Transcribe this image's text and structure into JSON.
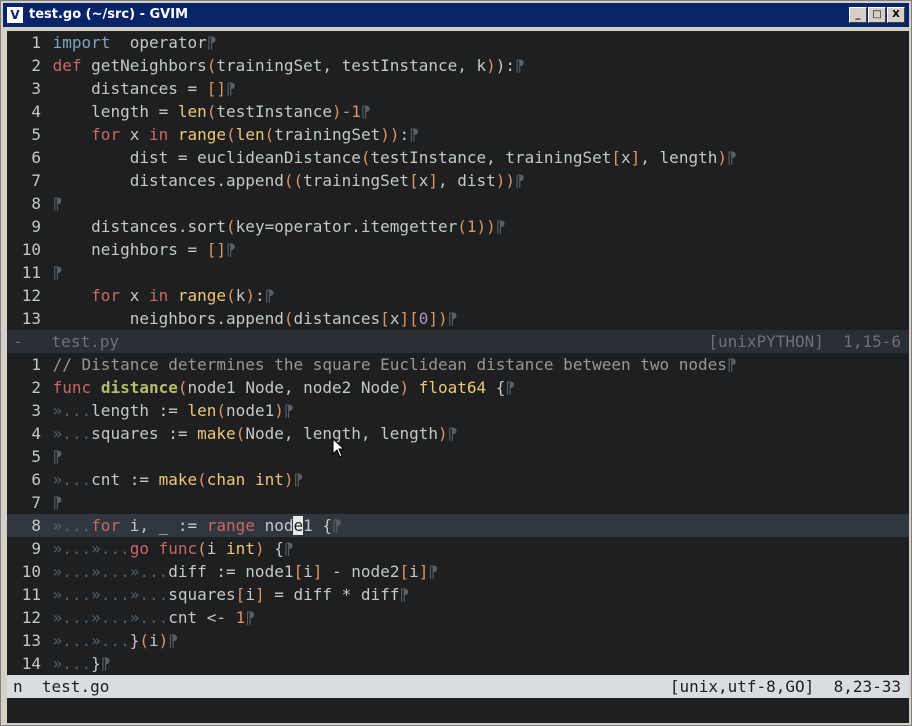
{
  "window": {
    "title": "test.go (~/src) - GVIM",
    "app_icon": "vim-icon",
    "buttons": [
      "_",
      "□",
      "X"
    ]
  },
  "top_pane": {
    "lines": [
      [
        [
          "kw",
          "import"
        ],
        [
          "",
          "  operator"
        ],
        [
          "eol",
          "⁋"
        ]
      ],
      [
        [
          "def",
          "def "
        ],
        [
          "",
          "getNeighbors"
        ],
        [
          "br",
          "("
        ],
        [
          "",
          "trainingSet, testInstance, k"
        ],
        [
          "br",
          ")"
        ],
        [
          "",
          "):"
        ],
        [
          "eol",
          "⁋"
        ]
      ],
      [
        [
          "",
          "    distances = "
        ],
        [
          "br",
          "[]"
        ],
        [
          "eol",
          "⁋"
        ]
      ],
      [
        [
          "",
          "    length = "
        ],
        [
          "fn",
          "len"
        ],
        [
          "br",
          "("
        ],
        [
          "",
          "testInstance"
        ],
        [
          "br",
          ")"
        ],
        [
          "num",
          "-1"
        ],
        [
          "eol",
          "⁋"
        ]
      ],
      [
        [
          "",
          "    "
        ],
        [
          "def",
          "for"
        ],
        [
          "",
          " x "
        ],
        [
          "def",
          "in"
        ],
        [
          "",
          " "
        ],
        [
          "fn",
          "range"
        ],
        [
          "br",
          "("
        ],
        [
          "fn",
          "len"
        ],
        [
          "br",
          "("
        ],
        [
          "",
          "trainingSet"
        ],
        [
          "br",
          "))"
        ],
        [
          "",
          ":"
        ],
        [
          "eol",
          "⁋"
        ]
      ],
      [
        [
          "",
          "        dist = euclideanDistance"
        ],
        [
          "br",
          "("
        ],
        [
          "",
          "testInstance, trainingSet"
        ],
        [
          "br",
          "["
        ],
        [
          "",
          "x"
        ],
        [
          "br",
          "]"
        ],
        [
          "",
          ", length"
        ],
        [
          "br",
          ")"
        ],
        [
          "eol",
          "⁋"
        ]
      ],
      [
        [
          "",
          "        distances.append"
        ],
        [
          "br",
          "(("
        ],
        [
          "",
          "trainingSet"
        ],
        [
          "br",
          "["
        ],
        [
          "",
          "x"
        ],
        [
          "br",
          "]"
        ],
        [
          "",
          ", dist"
        ],
        [
          "br",
          "))"
        ],
        [
          "eol",
          "⁋"
        ]
      ],
      [
        [
          "eol",
          "⁋"
        ]
      ],
      [
        [
          "",
          "    distances.sort"
        ],
        [
          "br",
          "("
        ],
        [
          "",
          "key=operator.itemgetter"
        ],
        [
          "br",
          "("
        ],
        [
          "num",
          "1"
        ],
        [
          "br",
          "))"
        ],
        [
          "eol",
          "⁋"
        ]
      ],
      [
        [
          "",
          "    neighbors = "
        ],
        [
          "br",
          "[]"
        ],
        [
          "eol",
          "⁋"
        ]
      ],
      [
        [
          "eol",
          "⁋"
        ]
      ],
      [
        [
          "",
          "    "
        ],
        [
          "def",
          "for"
        ],
        [
          "",
          " x "
        ],
        [
          "def",
          "in"
        ],
        [
          "",
          " "
        ],
        [
          "fn",
          "range"
        ],
        [
          "br",
          "("
        ],
        [
          "",
          "k"
        ],
        [
          "br",
          ")"
        ],
        [
          "",
          ":"
        ],
        [
          "eol",
          "⁋"
        ]
      ],
      [
        [
          "",
          "        neighbors.append"
        ],
        [
          "br",
          "("
        ],
        [
          "",
          "distances"
        ],
        [
          "br",
          "["
        ],
        [
          "",
          "x"
        ],
        [
          "br",
          "]["
        ],
        [
          "pur",
          "0"
        ],
        [
          "br",
          "])"
        ],
        [
          "eol",
          "⁋"
        ]
      ]
    ],
    "numbers": [
      "1",
      "2",
      "3",
      "4",
      "5",
      "6",
      "7",
      "8",
      "9",
      "10",
      "11",
      "12",
      "13"
    ],
    "status": {
      "marker": "-",
      "file": "test.py",
      "info": "[unixPYTHON]  1,15-6"
    }
  },
  "bottom_pane": {
    "lines": [
      [
        [
          "cmt",
          "// Distance determines the square Euclidean distance between two nodes"
        ],
        [
          "eol",
          "⁋"
        ]
      ],
      [
        [
          "def",
          "func "
        ],
        [
          "gfn",
          "distance"
        ],
        [
          "br",
          "("
        ],
        [
          "",
          "node1 Node, node2 Node"
        ],
        [
          "br",
          ")"
        ],
        [
          "fn",
          " float64"
        ],
        [
          "",
          " {"
        ],
        [
          "eol",
          "⁋"
        ]
      ],
      [
        [
          "tab",
          "»..."
        ],
        [
          "",
          "length := "
        ],
        [
          "fn",
          "len"
        ],
        [
          "br",
          "("
        ],
        [
          "",
          "node1"
        ],
        [
          "br",
          ")"
        ],
        [
          "eol",
          "⁋"
        ]
      ],
      [
        [
          "tab",
          "»..."
        ],
        [
          "",
          "squares := "
        ],
        [
          "fn",
          "make"
        ],
        [
          "br",
          "("
        ],
        [
          "",
          "Node, length, length"
        ],
        [
          "br",
          ")"
        ],
        [
          "eol",
          "⁋"
        ]
      ],
      [
        [
          "eol",
          "⁋"
        ]
      ],
      [
        [
          "tab",
          "»..."
        ],
        [
          "",
          "cnt := "
        ],
        [
          "fn",
          "make"
        ],
        [
          "br",
          "("
        ],
        [
          "fn",
          "chan int"
        ],
        [
          "br",
          ")"
        ],
        [
          "eol",
          "⁋"
        ]
      ],
      [
        [
          "eol",
          "⁋"
        ]
      ],
      [
        [
          "tab",
          "»..."
        ],
        [
          "def",
          "for"
        ],
        [
          "",
          " i, _ := "
        ],
        [
          "def",
          "range"
        ],
        [
          "",
          " nod"
        ],
        [
          "cursor",
          "e"
        ],
        [
          "",
          "1 {"
        ],
        [
          "eol",
          "⁋"
        ]
      ],
      [
        [
          "tab",
          "»...»..."
        ],
        [
          "def",
          "go "
        ],
        [
          "def",
          "func"
        ],
        [
          "br",
          "("
        ],
        [
          "",
          "i "
        ],
        [
          "fn",
          "int"
        ],
        [
          "br",
          ")"
        ],
        [
          "",
          " {"
        ],
        [
          "eol",
          "⁋"
        ]
      ],
      [
        [
          "tab",
          "»...»...»..."
        ],
        [
          "",
          "diff := node1"
        ],
        [
          "br",
          "["
        ],
        [
          "",
          "i"
        ],
        [
          "br",
          "]"
        ],
        [
          "",
          " - node2"
        ],
        [
          "br",
          "["
        ],
        [
          "",
          "i"
        ],
        [
          "br",
          "]"
        ],
        [
          "eol",
          "⁋"
        ]
      ],
      [
        [
          "tab",
          "»...»...»..."
        ],
        [
          "",
          "squares"
        ],
        [
          "br",
          "["
        ],
        [
          "",
          "i"
        ],
        [
          "br",
          "]"
        ],
        [
          "",
          " = diff * diff"
        ],
        [
          "eol",
          "⁋"
        ]
      ],
      [
        [
          "tab",
          "»...»...»..."
        ],
        [
          "",
          "cnt <- "
        ],
        [
          "num",
          "1"
        ],
        [
          "eol",
          "⁋"
        ]
      ],
      [
        [
          "tab",
          "»...»..."
        ],
        [
          "",
          "}"
        ],
        [
          "br",
          "("
        ],
        [
          "",
          "i"
        ],
        [
          "br",
          ")"
        ],
        [
          "eol",
          "⁋"
        ]
      ],
      [
        [
          "tab",
          "»..."
        ],
        [
          "",
          "}"
        ],
        [
          "eol",
          "⁋"
        ]
      ]
    ],
    "numbers": [
      "1",
      "2",
      "3",
      "4",
      "5",
      "6",
      "7",
      "8",
      "9",
      "10",
      "11",
      "12",
      "13",
      "14"
    ],
    "current_line": 8,
    "status": {
      "marker": "n",
      "file": "test.go",
      "info": "[unix,utf-8,GO]  8,23-33"
    }
  },
  "colors": {
    "background": "#1d1f21",
    "keyword": "#81a2be",
    "def": "#cc6666",
    "builtin": "#f0c674",
    "number": "#de935f"
  }
}
